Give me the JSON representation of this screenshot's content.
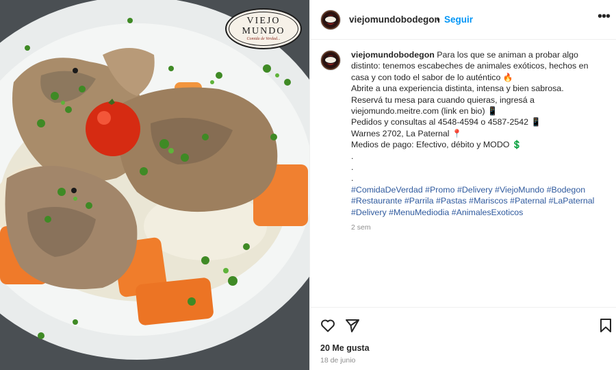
{
  "post": {
    "logo": {
      "line1": "VIEJO",
      "line2": "MUNDO",
      "tagline": "Comida de Verdad..."
    },
    "header": {
      "username": "viejomundobodegon",
      "separator": "•",
      "follow_label": "Seguir",
      "more_icon": "more-options-icon"
    },
    "caption": {
      "username": "viejomundobodegon",
      "line1": "Para los que se animan a probar algo distinto: tenemos escabeches de animales exóticos, hechos en casa y con todo el sabor de lo auténtico",
      "line1_emoji": "🔥",
      "line2": "Abrite a una experiencia distinta, intensa y bien sabrosa.",
      "line3": "Reservá tu mesa para cuando quieras, ingresá a viejomundo.meitre.com (link en bio)",
      "line3_emoji": "📱",
      "line4": "Pedidos y consultas al 4548-4594 o 4587-2542",
      "line4_emoji": "📱",
      "line5": "Warnes 2702, La Paternal",
      "line5_emoji": "📍",
      "line6": "Medios de pago: Efectivo, débito y MODO",
      "line6_emoji": "💲",
      "dots": ".",
      "hashtags": "#ComidaDeVerdad #Promo #Delivery #ViejoMundo #Bodegon #Restaurante #Parrila #Pastas #Mariscos #Paternal #LaPaternal #Delivery #MenuMediodia #AnimalesExoticos"
    },
    "relative_time": "2 sem",
    "likes_text": "20 Me gusta",
    "date": "18 de junio",
    "colors": {
      "link": "#0095f6",
      "hashtag": "#2f5a9e",
      "muted": "#8e8e8e",
      "text": "#262626"
    }
  }
}
